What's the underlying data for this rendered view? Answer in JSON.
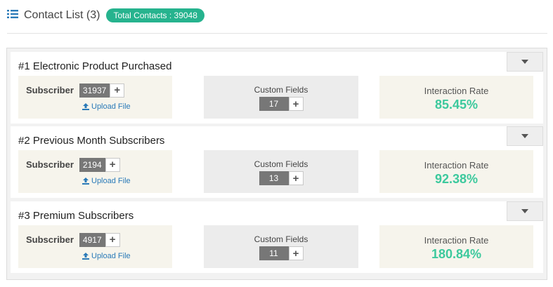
{
  "header": {
    "icon": "list-icon",
    "title": "Contact List (3)",
    "total_badge": "Total Contacts : 39048",
    "accent_color": "#26b38e"
  },
  "contacts": [
    {
      "title": "#1 Electronic Product Purchased",
      "subscriber_label": "Subscriber",
      "subscriber_count": "31937",
      "upload_label": "Upload File",
      "custom_fields_label": "Custom Fields",
      "custom_fields_count": "17",
      "interaction_label": "Interaction Rate",
      "interaction_rate": "85.45%"
    },
    {
      "title": "#2 Previous Month Subscribers",
      "subscriber_label": "Subscriber",
      "subscriber_count": "2194",
      "upload_label": "Upload File",
      "custom_fields_label": "Custom Fields",
      "custom_fields_count": "13",
      "interaction_label": "Interaction Rate",
      "interaction_rate": "92.38%"
    },
    {
      "title": "#3 Premium Subscribers",
      "subscriber_label": "Subscriber",
      "subscriber_count": "4917",
      "upload_label": "Upload File",
      "custom_fields_label": "Custom Fields",
      "custom_fields_count": "11",
      "interaction_label": "Interaction Rate",
      "interaction_rate": "180.84%"
    }
  ],
  "icons": {
    "plus": "+",
    "toggle": "caret-down-icon",
    "upload": "upload-icon"
  }
}
